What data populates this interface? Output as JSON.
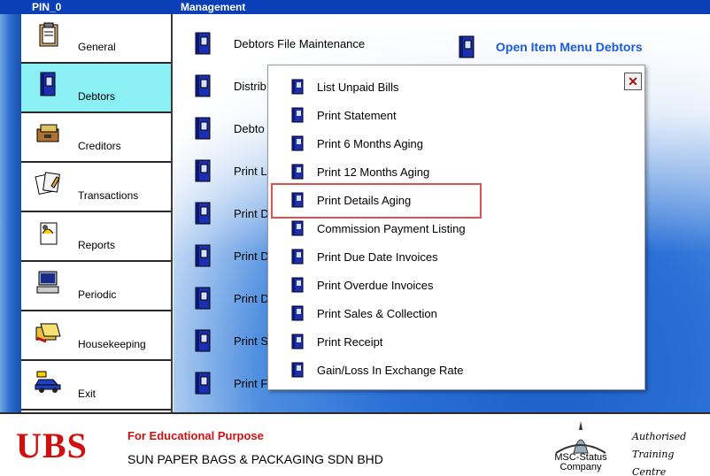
{
  "titles": {
    "left": "PIN_0",
    "right": "Management"
  },
  "sidebar": {
    "items": [
      {
        "label": "General",
        "icon": "clipboard-icon"
      },
      {
        "label": "Debtors",
        "icon": "book-icon",
        "active": true
      },
      {
        "label": "Creditors",
        "icon": "cashbox-icon"
      },
      {
        "label": "Transactions",
        "icon": "documents-icon"
      },
      {
        "label": "Reports",
        "icon": "report-icon"
      },
      {
        "label": "Periodic",
        "icon": "computer-icon"
      },
      {
        "label": "Housekeeping",
        "icon": "folders-icon"
      },
      {
        "label": "Exit",
        "icon": "car-icon"
      }
    ]
  },
  "main": {
    "items": [
      "Debtors File Maintenance",
      "Distrib",
      "Debto",
      "Print L",
      "Print D",
      "Print D",
      "Print D",
      "Print S",
      "Print F"
    ],
    "open_item": "Open Item Menu Debtors"
  },
  "popup": {
    "close": "✕",
    "items": [
      "List Unpaid Bills",
      "Print Statement",
      "Print 6 Months Aging",
      "Print 12 Months Aging",
      "Print Details Aging",
      "Commission Payment Listing",
      "Print Due Date Invoices",
      "Print Overdue Invoices",
      "Print Sales & Collection",
      "Print Receipt",
      "Gain/Loss In Exchange Rate"
    ],
    "highlighted_index": 4
  },
  "footer": {
    "brand": "UBS",
    "edu_text": "For Educational Purpose",
    "company": "SUN PAPER BAGS & PACKAGING SDN BHD",
    "msc_line1": "MSC-Status",
    "msc_line2": "Company",
    "auth_line1": "Authorised",
    "auth_line2": "Training Centre"
  },
  "colors": {
    "title_bar": "#0a3fb8",
    "active_item": "#8af0f4",
    "brand_red": "#d01010",
    "link_blue": "#1a5cd8",
    "highlight_border": "#d9534f"
  }
}
